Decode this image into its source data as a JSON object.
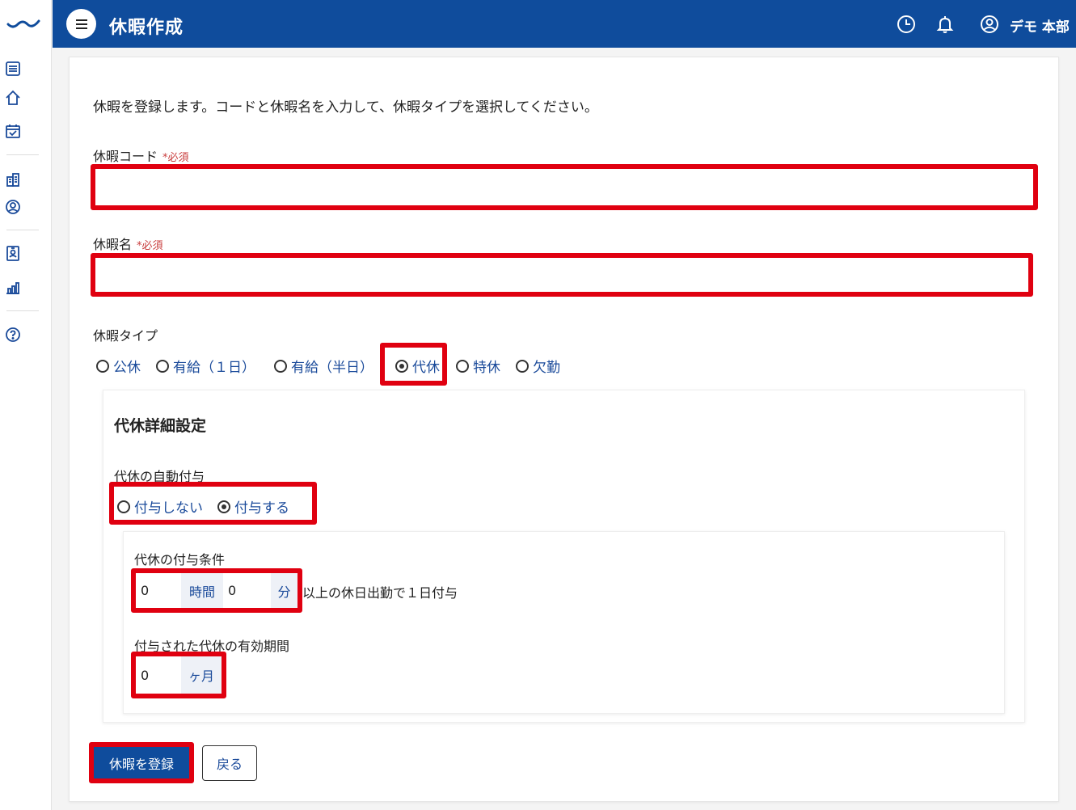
{
  "header": {
    "title": "休暇作成",
    "user": "デモ 本部"
  },
  "intro": "休暇を登録します。コードと休暇名を入力して、休暇タイプを選択してください。",
  "form": {
    "code_label": "休暇コード",
    "name_label": "休暇名",
    "required": "*必須",
    "code_value": "",
    "name_value": "",
    "type_label": "休暇タイプ",
    "types": [
      "公休",
      "有給（１日）",
      "有給（半日）",
      "代休",
      "特休",
      "欠勤"
    ],
    "selected_type": "代休"
  },
  "detail": {
    "title": "代休詳細設定",
    "auto_label": "代休の自動付与",
    "auto_options": [
      "付与しない",
      "付与する"
    ],
    "auto_selected": "付与する",
    "condition_label": "代休の付与条件",
    "hours_value": "0",
    "hours_unit": "時間",
    "minutes_value": "0",
    "minutes_unit": "分",
    "condition_suffix": "以上の休日出勤で１日付与",
    "validity_label": "付与された代休の有効期間",
    "months_value": "0",
    "months_unit": "ヶ月"
  },
  "buttons": {
    "submit": "休暇を登録",
    "back": "戻る"
  },
  "colors": {
    "primary": "#0f4c9c",
    "highlight": "#e00010",
    "required": "#c83c3c"
  },
  "icons": {
    "sidebar": [
      "list-icon",
      "home-icon",
      "calendar-check-icon",
      "building-icon",
      "user-circle-icon",
      "id-badge-icon",
      "bar-chart-icon",
      "help-icon"
    ],
    "header": [
      "menu-icon",
      "clock-icon",
      "bell-icon",
      "user-circle-icon"
    ]
  }
}
